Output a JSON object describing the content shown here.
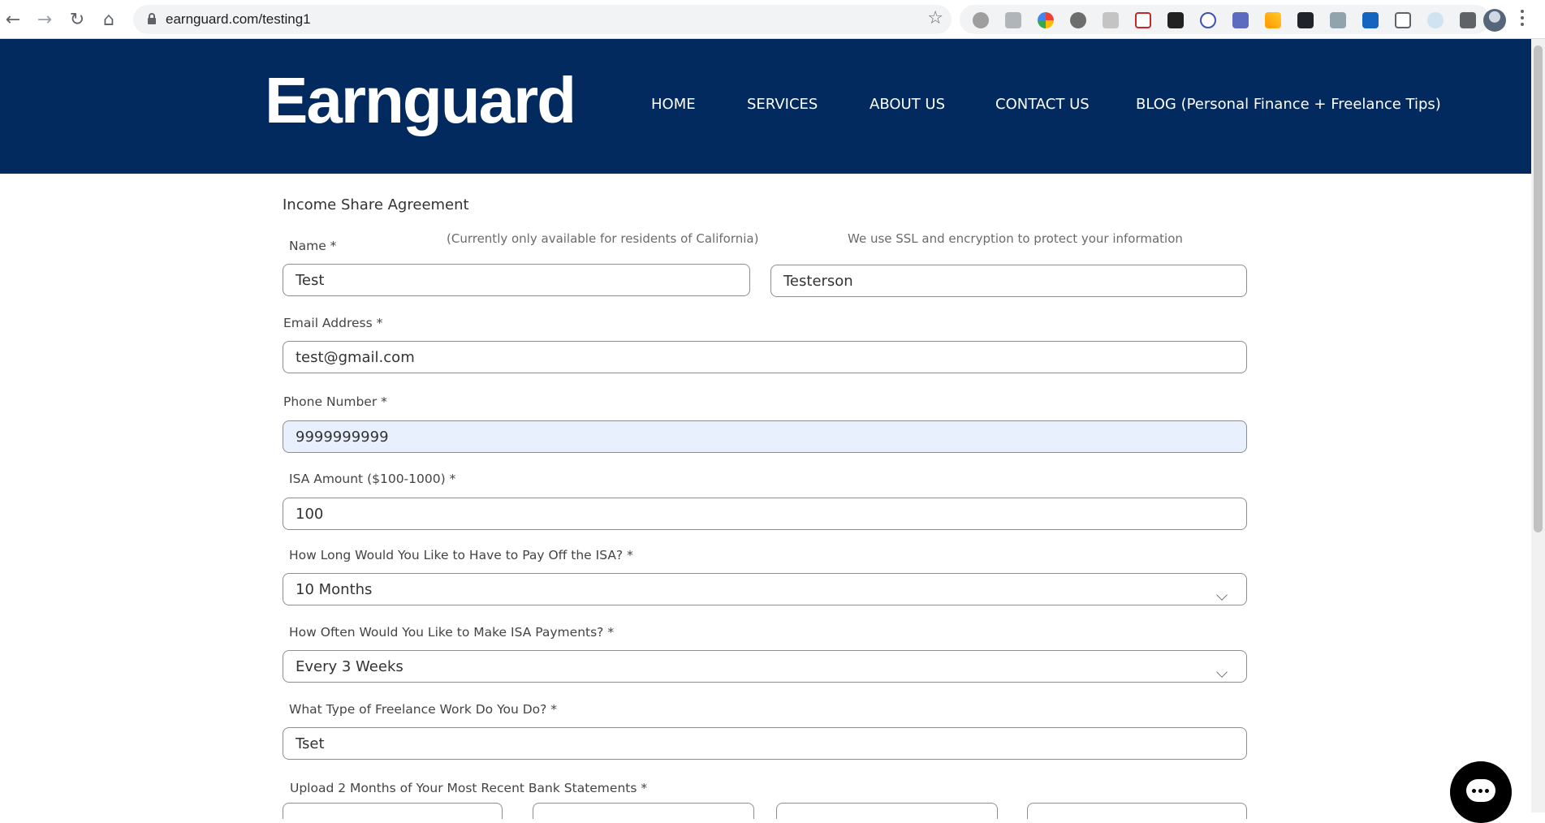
{
  "browser": {
    "url": "earnguard.com/testing1",
    "icons": [
      "back-arrow-icon",
      "forward-arrow-icon",
      "reload-icon",
      "home-icon",
      "lock-icon",
      "bookmark-star-icon",
      "extensions-icon",
      "profile-avatar",
      "menu-kebab-icon"
    ]
  },
  "header": {
    "logo": "Earnguard",
    "bg_color": "#032a5e",
    "nav": [
      "HOME",
      "SERVICES",
      "ABOUT US",
      "CONTACT US",
      "BLOG (Personal Finance + Freelance Tips)"
    ]
  },
  "form": {
    "title": "Income Share Agreement",
    "name_label": "Name *",
    "residency_note": "(Currently only available for residents of California)",
    "ssl_note": "We use SSL and encryption to protect your information",
    "first_name": "Test",
    "last_name": "Testerson",
    "email_label": "Email Address *",
    "email": "test@gmail.com",
    "phone_label": "Phone Number *",
    "phone": "9999999999",
    "isa_amount_label": "ISA Amount ($100-1000) *",
    "isa_amount": "100",
    "payoff_label": "How Long Would You Like to Have to Pay Off the ISA? *",
    "payoff_selected": "10 Months",
    "frequency_label": "How Often Would You Like to Make ISA Payments? *",
    "frequency_selected": "Every 3 Weeks",
    "work_label": "What Type of Freelance Work Do You Do? *",
    "work": "Tset",
    "upload_label": "Upload 2 Months of Your Most Recent Bank Statements *"
  }
}
